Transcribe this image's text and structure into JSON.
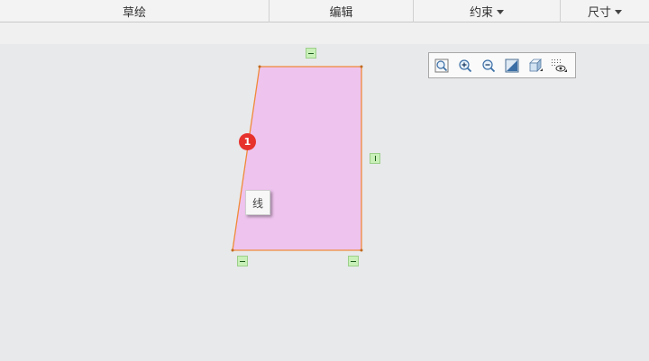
{
  "ribbon": {
    "sketch": "草绘",
    "edit": "编辑",
    "constrain": "约束",
    "dimension": "尺寸"
  },
  "canvas": {
    "badge_number": "1",
    "tooltip_text": "线",
    "shape_fill": "#eec4ee",
    "edge_color": "#f08a3a"
  },
  "view_toolbar": {
    "icons": [
      "zoom-fit-icon",
      "zoom-in-icon",
      "zoom-out-icon",
      "repaint-icon",
      "display-style-icon",
      "sketch-display-icon"
    ]
  }
}
